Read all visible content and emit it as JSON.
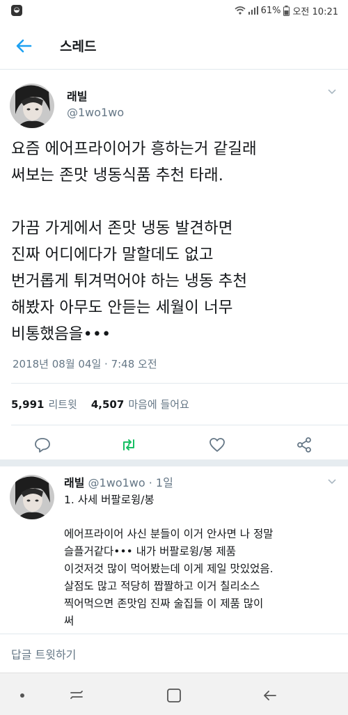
{
  "status_bar": {
    "app_icon": "app-notification-icon",
    "battery": "61%",
    "time": "오전 10:21"
  },
  "header": {
    "title": "스레드",
    "back_icon": "arrow-left-icon"
  },
  "main_tweet": {
    "author_name": "래빌",
    "author_handle": "@1wo1wo",
    "lines": [
      "요즘 에어프라이어가 흥하는거 같길래",
      "써보는 존맛 냉동식품 추천 타래.",
      "",
      "가끔 가게에서 존맛 냉동 발견하면",
      "진짜 어디에다가 말할데도 없고",
      "번거롭게 튀겨먹어야 하는 냉동 추천",
      "해봤자 아무도 안듣는 세월이 너무",
      "비통했음을•••"
    ],
    "timestamp": "2018년 08월 04일 · 7:48 오전",
    "retweet_count": "5,991",
    "retweet_label": "리트윗",
    "like_count": "4,507",
    "like_label": "마음에 들어요"
  },
  "reply_tweet": {
    "author_name": "래빌",
    "author_handle": "@1wo1wo",
    "time_ago": "· 1일",
    "lines": [
      "1. 사세 버팔로윙/봉",
      "",
      "에어프라이어 사신 분들이 이거 안사면 나 정말",
      "슬플거같다••• 내가 버팔로윙/봉 제품",
      "이것저것 많이 먹어봤는데 이게 제일 맛있었음.",
      "살점도 많고 적당히 짭짤하고 이거 칠리소스",
      "찍어먹으면 존맛임 진짜 술집들 이 제품 많이",
      "써"
    ]
  },
  "reply_bar": {
    "placeholder": "답글 트윗하기"
  },
  "colors": {
    "accent": "#1da1f2",
    "retweet_green": "#17bf63",
    "secondary_text": "#657786",
    "divider": "#e1e8ed"
  }
}
